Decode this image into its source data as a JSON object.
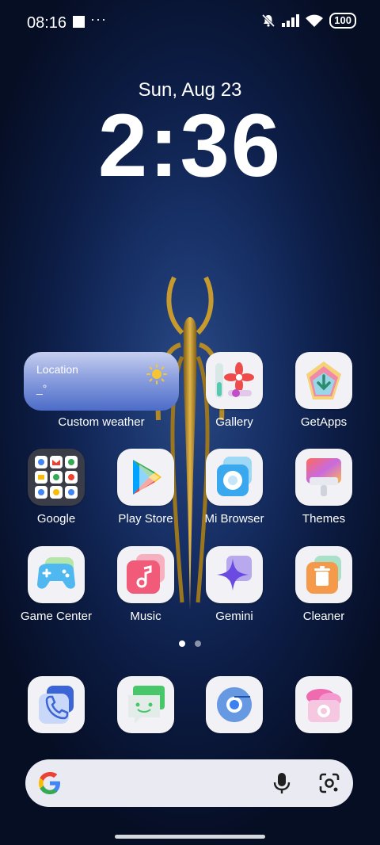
{
  "status": {
    "time": "08:16",
    "extra": "···",
    "battery": "100",
    "icons": [
      "notification-square-icon",
      "silent-bell-icon",
      "signal-icon",
      "wifi-icon"
    ]
  },
  "lockscreen": {
    "date": "Sun, Aug 23",
    "time": "2:36"
  },
  "weather_widget": {
    "title": "Location",
    "value": "_°",
    "caption": "Custom weather"
  },
  "apps": [
    {
      "label": "Gallery"
    },
    {
      "label": "GetApps"
    },
    {
      "label": "Google"
    },
    {
      "label": "Play Store"
    },
    {
      "label": "Mi Browser"
    },
    {
      "label": "Themes"
    },
    {
      "label": "Game Center"
    },
    {
      "label": "Music"
    },
    {
      "label": "Gemini"
    },
    {
      "label": "Cleaner"
    }
  ],
  "dock": [
    "phone-icon",
    "messages-icon",
    "chrome-icon",
    "camera-icon"
  ],
  "pages": {
    "count": 2,
    "active": 1
  },
  "colors": {
    "search_bg": "#e9eaf2",
    "accent_blue": "#3b64d6"
  }
}
